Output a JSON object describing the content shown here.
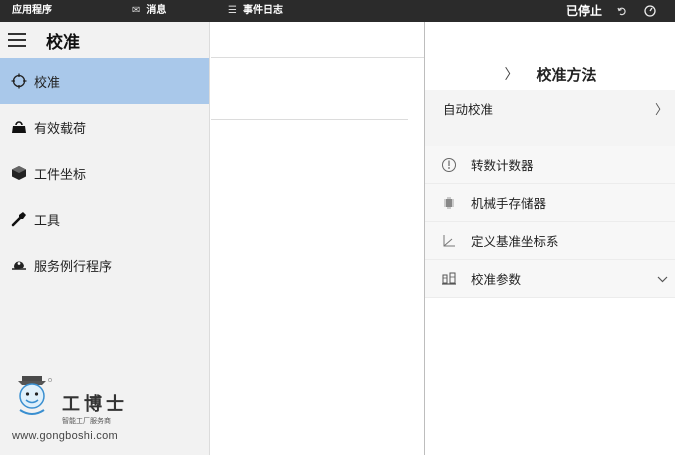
{
  "topbar": {
    "app_label": "应用程序",
    "messages_label": "消息",
    "event_log_label": "事件日志",
    "status_label": "已停止"
  },
  "sidebar": {
    "title": "校准",
    "items": [
      {
        "label": "校准",
        "icon": "crosshair-icon",
        "active": true
      },
      {
        "label": "有效载荷",
        "icon": "payload-icon",
        "active": false
      },
      {
        "label": "工件坐标",
        "icon": "workobject-icon",
        "active": false
      },
      {
        "label": "工具",
        "icon": "tool-icon",
        "active": false
      },
      {
        "label": "服务例行程序",
        "icon": "service-icon",
        "active": false
      }
    ]
  },
  "logo": {
    "brand": "工博士",
    "sub": "智能工厂服务商",
    "url": "www.gongboshi.com"
  },
  "right_panel": {
    "header": "校准方法",
    "auto_calibration": "自动校准",
    "rows": [
      {
        "label": "转数计数器",
        "icon": "revolution-counter-icon"
      },
      {
        "label": "机械手存储器",
        "icon": "memory-icon"
      },
      {
        "label": "定义基准坐标系",
        "icon": "base-frame-icon"
      },
      {
        "label": "校准参数",
        "icon": "calibration-parameters-icon"
      }
    ]
  },
  "colors": {
    "topbar_bg": "#2b2b2b",
    "active_item_bg": "#a9c8ea",
    "sidebar_bg": "#f2f2f2"
  }
}
